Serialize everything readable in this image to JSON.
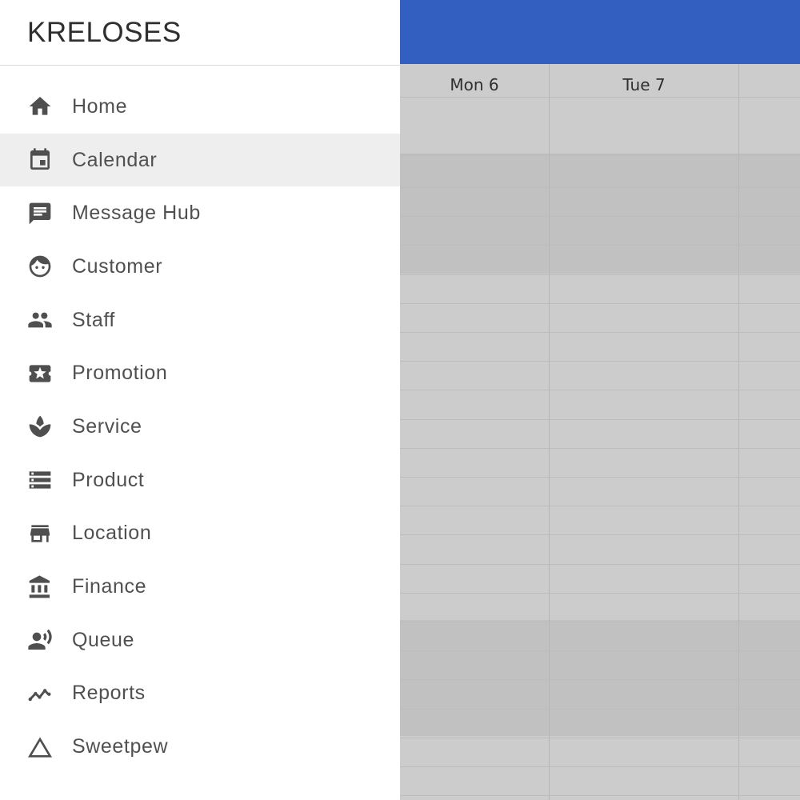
{
  "app": {
    "brand": "KRELOSES",
    "accent_color": "#325fc0"
  },
  "drawer": {
    "items": [
      {
        "label": "Home",
        "icon": "home-icon",
        "active": false
      },
      {
        "label": "Calendar",
        "icon": "calendar-icon",
        "active": true
      },
      {
        "label": "Message Hub",
        "icon": "message-icon",
        "active": false
      },
      {
        "label": "Customer",
        "icon": "face-icon",
        "active": false
      },
      {
        "label": "Staff",
        "icon": "people-icon",
        "active": false
      },
      {
        "label": "Promotion",
        "icon": "ticket-star-icon",
        "active": false
      },
      {
        "label": "Service",
        "icon": "spa-icon",
        "active": false
      },
      {
        "label": "Product",
        "icon": "storage-icon",
        "active": false
      },
      {
        "label": "Location",
        "icon": "store-icon",
        "active": false
      },
      {
        "label": "Finance",
        "icon": "bank-icon",
        "active": false
      },
      {
        "label": "Queue",
        "icon": "voice-person-icon",
        "active": false
      },
      {
        "label": "Reports",
        "icon": "trend-line-icon",
        "active": false
      },
      {
        "label": "Sweetpew",
        "icon": "triangle-icon",
        "active": false
      }
    ]
  },
  "calendar": {
    "days": [
      {
        "label": "Mon 6"
      },
      {
        "label": "Tue 7"
      }
    ]
  }
}
